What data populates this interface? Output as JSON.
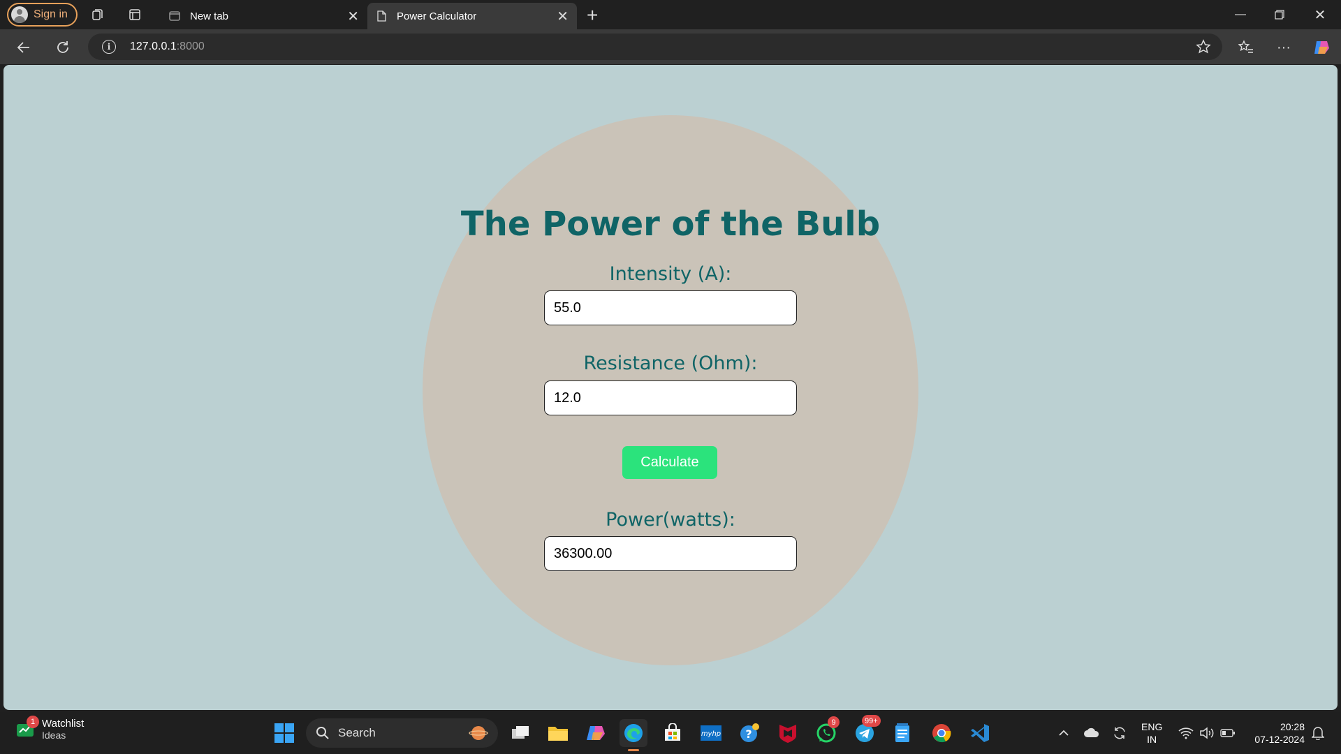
{
  "browser": {
    "signin_label": "Sign in",
    "tabs": [
      {
        "title": "New tab",
        "active": false
      },
      {
        "title": "Power Calculator",
        "active": true
      }
    ],
    "address": {
      "host": "127.0.0.1",
      "port": ":8000"
    }
  },
  "page": {
    "title": "The Power of the Bulb",
    "intensity_label": "Intensity (A):",
    "intensity_value": "55.0",
    "resistance_label": "Resistance (Ohm):",
    "resistance_value": "12.0",
    "calculate_label": "Calculate",
    "power_label": "Power(watts):",
    "power_value": "36300.00",
    "colors": {
      "background": "#bbd0d2",
      "circle": "#cac3b8",
      "heading": "#0f6466",
      "button": "#2be37c"
    }
  },
  "taskbar": {
    "widget_title": "Watchlist",
    "widget_subtitle": "Ideas",
    "widget_badge": "1",
    "search_label": "Search",
    "whatsapp_badge": "9",
    "telegram_badge": "99+",
    "lang_line1": "ENG",
    "lang_line2": "IN",
    "time": "20:28",
    "date": "07-12-2024"
  }
}
